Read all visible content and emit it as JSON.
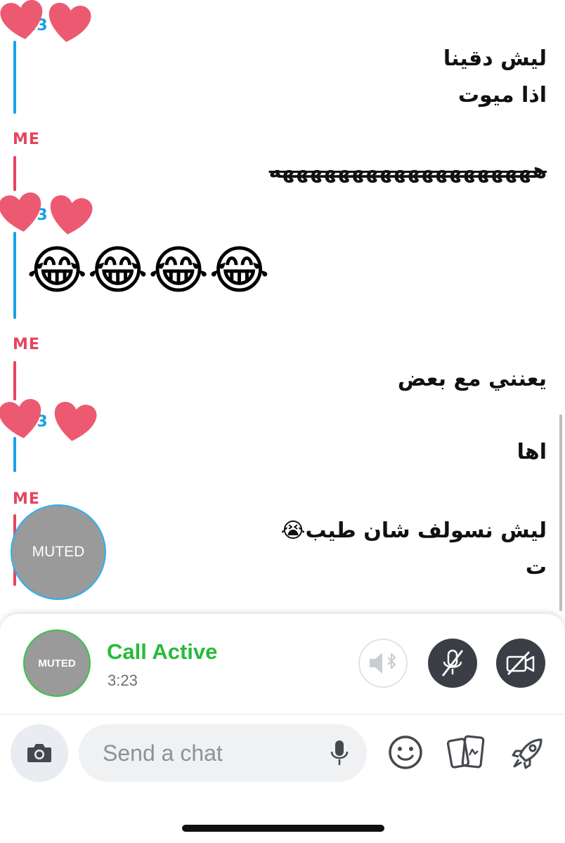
{
  "conversation": [
    {
      "sender": "A23",
      "sender_color": "#1aa1e6",
      "lines": [
        "ليش دقينا",
        "اذا ميوت"
      ]
    },
    {
      "sender": "ME",
      "sender_color": "#e5455e",
      "lines": [
        "هههههههههههههههههههه"
      ],
      "strikethrough": true
    },
    {
      "sender": "A23",
      "sender_color": "#1aa1e6",
      "emoji": "😂😂😂😂"
    },
    {
      "sender": "ME",
      "sender_color": "#e5455e",
      "lines": [
        "يعنني مع بعض"
      ]
    },
    {
      "sender": "A23",
      "sender_color": "#1aa1e6",
      "lines": [
        "اها"
      ]
    },
    {
      "sender": "ME",
      "sender_color": "#e5455e",
      "lines": [
        "ليش نسولف شان طيب😭",
        "ت"
      ]
    }
  ],
  "overlay": {
    "muted_label": "MUTED"
  },
  "call": {
    "avatar_label": "MUTED",
    "status": "Call Active",
    "duration": "3:23",
    "status_color": "#27bb3b"
  },
  "composer": {
    "placeholder": "Send a chat"
  },
  "icons": [
    "heart-icon",
    "speaker-bluetooth-icon",
    "mic-off-icon",
    "video-off-icon",
    "camera-icon",
    "mic-icon",
    "smiley-icon",
    "stickers-icon",
    "rocket-icon"
  ]
}
